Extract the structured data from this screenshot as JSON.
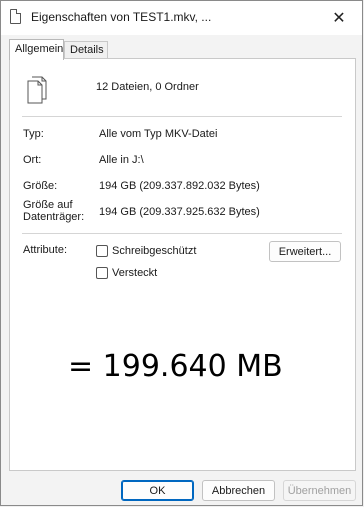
{
  "window": {
    "title": "Eigenschaften von TEST1.mkv, ...",
    "close_glyph": "✕"
  },
  "tabs": [
    {
      "label": "Allgemein",
      "active": true
    },
    {
      "label": "Details",
      "active": false
    }
  ],
  "summary": {
    "icon": "multiple-files-icon",
    "count_text": "12 Dateien, 0 Ordner"
  },
  "properties": {
    "type_label": "Typ:",
    "type_value": "Alle vom Typ MKV-Datei",
    "location_label": "Ort:",
    "location_value": "Alle in J:\\",
    "size_label": "Größe:",
    "size_value": "194 GB (209.337.892.032 Bytes)",
    "disk_size_label_line1": "Größe auf",
    "disk_size_label_line2": "Datenträger:",
    "disk_size_value": "194 GB (209.337.925.632 Bytes)"
  },
  "attributes": {
    "label": "Attribute:",
    "readonly_label": "Schreibgeschützt",
    "readonly_checked": false,
    "hidden_label": "Versteckt",
    "hidden_checked": false,
    "advanced_button": "Erweitert..."
  },
  "overlay": {
    "text": "= 199.640 MB"
  },
  "footer": {
    "ok": "OK",
    "cancel": "Abbrechen",
    "apply": "Übernehmen"
  },
  "colors": {
    "accent": "#0067c0",
    "disabled_text": "#a0a0a0"
  }
}
